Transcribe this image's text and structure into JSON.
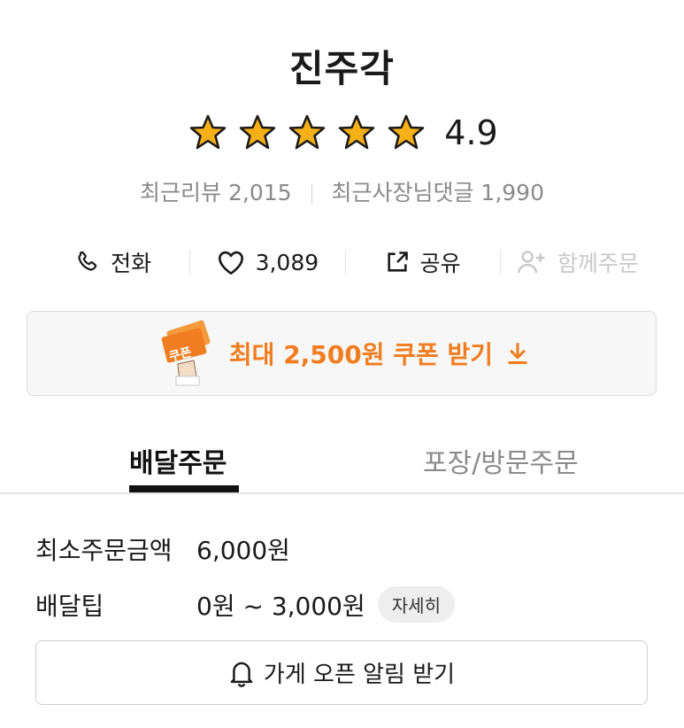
{
  "store": {
    "name": "진주각"
  },
  "rating": {
    "value": "4.9",
    "stars": 5,
    "star_color": "#f5b017"
  },
  "reviews": {
    "recent_reviews_label": "최근리뷰",
    "recent_reviews_count": "2,015",
    "owner_replies_label": "최근사장님댓글",
    "owner_replies_count": "1,990"
  },
  "actions": {
    "call_label": "전화",
    "like_count": "3,089",
    "share_label": "공유",
    "group_order_label": "함께주문"
  },
  "coupon": {
    "label": "최대 2,500원 쿠폰 받기",
    "ticket_text": "쿠폰",
    "accent": "#f07d1f"
  },
  "tabs": [
    {
      "label": "배달주문",
      "active": true
    },
    {
      "label": "포장/방문주문",
      "active": false
    }
  ],
  "order_info": {
    "min_order_label": "최소주문금액",
    "min_order_value": "6,000원",
    "delivery_tip_label": "배달팁",
    "delivery_tip_value": "0원 ~ 3,000원",
    "detail_button": "자세히"
  },
  "alarm": {
    "label": "가게 오픈 알림 받기"
  }
}
